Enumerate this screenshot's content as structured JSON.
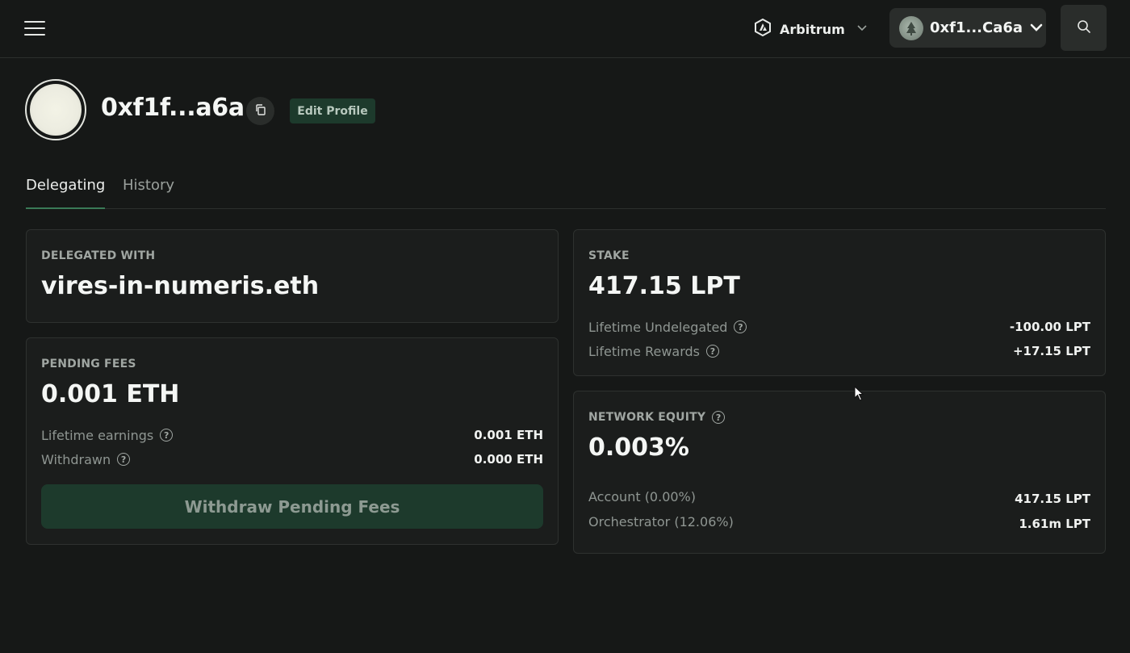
{
  "header": {
    "menu_icon": "hamburger-menu-icon",
    "network": {
      "icon": "arbitrum-logo-icon",
      "label": "Arbitrum",
      "chevron": "chevron-down-icon"
    },
    "account": {
      "icon": "account-avatar-icon",
      "label": "0xf1...Ca6a",
      "chevron": "chevron-down-icon"
    },
    "search_icon": "search-icon"
  },
  "profile": {
    "avatar": "profile-avatar",
    "name": "0xf1f...a6a",
    "copy_icon": "copy-icon",
    "edit_label": "Edit Profile"
  },
  "tabs": [
    {
      "label": "Delegating",
      "active": true
    },
    {
      "label": "History",
      "active": false
    }
  ],
  "delegated": {
    "label": "DELEGATED WITH",
    "value": "vires-in-numeris.eth"
  },
  "pending_fees": {
    "label": "PENDING FEES",
    "value": "0.001 ETH",
    "rows": [
      {
        "label": "Lifetime earnings",
        "value": "0.001 ETH"
      },
      {
        "label": "Withdrawn",
        "value": "0.000 ETH"
      }
    ],
    "button_label": "Withdraw Pending Fees"
  },
  "stake": {
    "label": "STAKE",
    "value": "417.15 LPT",
    "rows": [
      {
        "label": "Lifetime Undelegated",
        "value": "-100.00 LPT"
      },
      {
        "label": "Lifetime Rewards",
        "value": "+17.15 LPT"
      }
    ]
  },
  "network_equity": {
    "label": "NETWORK EQUITY",
    "value": "0.003%",
    "rows": [
      {
        "label": "Account (0.00%)",
        "value": "417.15 LPT"
      },
      {
        "label": "Orchestrator (12.06%)",
        "value": "1.61m LPT"
      }
    ]
  },
  "help_glyph": "?",
  "colors": {
    "background": "#161817",
    "card": "#1b1d1c",
    "accent_green": "#1d3a2c",
    "tab_underline": "#3a7a57"
  }
}
